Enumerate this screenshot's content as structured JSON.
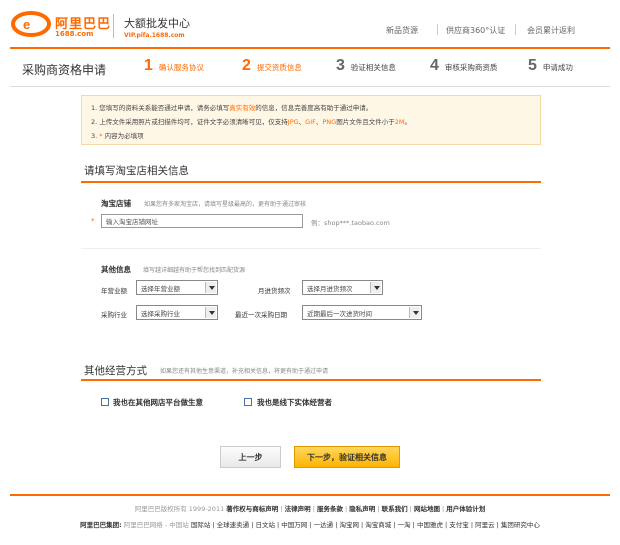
{
  "header": {
    "logo_cn": "阿里巴巴",
    "logo_domain": "1688.com",
    "site_title": "大额批发中心",
    "site_sub": "VIP.pifa.1688.com",
    "nav": [
      "新品货源",
      "供应商360°认证",
      "会员累计返利"
    ]
  },
  "steps": {
    "page_title": "采购商资格申请",
    "items": [
      {
        "num": "1",
        "label": "确认服务协议"
      },
      {
        "num": "2",
        "label": "提交资质信息"
      },
      {
        "num": "3",
        "label": "验证相关信息"
      },
      {
        "num": "4",
        "label": "审核采购商资质"
      },
      {
        "num": "5",
        "label": "申请成功"
      }
    ]
  },
  "notice": {
    "l1_a": "1. 您填写的资料关系能否通过申请，请务必填写",
    "l1_hl": "真实有效",
    "l1_b": "的信息，信息完善度高有助于通过申请。",
    "l2_a": "2. 上传文件采用照片或扫描件均可，证件文字必须清晰可见，仅支持",
    "l2_jpg": "JPG",
    "l2_c1": "、",
    "l2_gif": "GIF",
    "l2_c2": "、",
    "l2_png": "PNG",
    "l2_b": "图片文件且文件小于",
    "l2_size": "2M",
    "l2_end": "。",
    "l3_num": "3.",
    "l3_star": "*",
    "l3_text": "内容为必填项"
  },
  "taobao_section": {
    "title": "请填写淘宝店相关信息",
    "field_label": "淘宝店铺",
    "field_hint": "如果您有多家淘宝店，请填写星级最高的，更有助于通过审核",
    "required_mark": "*",
    "input_value": "输入淘宝店铺网址",
    "example": "例：shop***.taobao.com"
  },
  "other_info": {
    "label": "其他信息",
    "hint": "填写越详细越有助于帮您找到匹配货源",
    "annual_label": "年营业额",
    "annual_value": "选择年营业额",
    "frequency_label": "月进货频次",
    "frequency_value": "选择月进货频次",
    "industry_label": "采购行业",
    "industry_value": "选择采购行业",
    "last_date_label": "最近一次采购日期",
    "last_date_value": "近期最后一次进货时间"
  },
  "channels": {
    "title": "其他经营方式",
    "hint": "如果您还有其他生意渠道，补充相关信息，将更有助于通过申请",
    "option_a": "我也在其他网店平台做生意",
    "option_b": "我也是线下实体经营者"
  },
  "buttons": {
    "prev": "上一步",
    "next": "下一步，验证相关信息"
  },
  "footer": {
    "copyright": "阿里巴巴版权所有 1999-2011",
    "links": [
      "著作权与商标声明",
      "法律声明",
      "服务条款",
      "隐私声明",
      "联系我们",
      "网站地图",
      "用户体验计划"
    ],
    "group_title": "阿里巴巴集团:",
    "group_sub": "阿里巴巴网络 - 中国站",
    "group_links": [
      "国际站",
      "全球速卖通",
      "日文站",
      "中国万网",
      "一达通",
      "淘宝网",
      "淘宝商城",
      "一淘",
      "中国雅虎",
      "支付宝",
      "阿里云",
      "集团研究中心"
    ]
  },
  "colors": {
    "accent": "#ff6a00",
    "notice_bg": "#fff7e6",
    "next_btn": "#ffb400"
  }
}
